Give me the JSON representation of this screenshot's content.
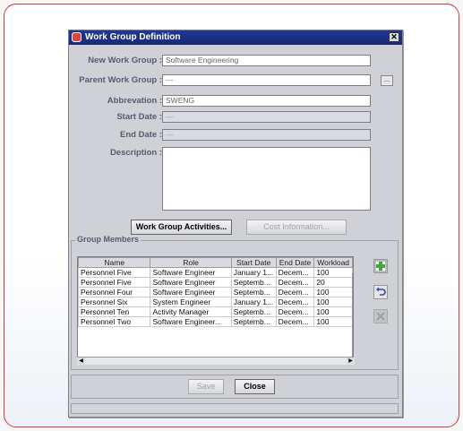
{
  "dialog": {
    "title": "Work Group Definition",
    "close_glyph": "✕"
  },
  "form": {
    "new_work_group_label": "New Work Group :",
    "new_work_group_value": "Software Engineering",
    "parent_work_group_label": "Parent Work Group :",
    "parent_work_group_value": "---",
    "browse_label": "...",
    "abbreviation_label": "Abbrevation :",
    "abbreviation_value": "SWENG",
    "start_date_label": "Start Date :",
    "start_date_value": "---",
    "end_date_label": "End Date :",
    "end_date_value": "---",
    "description_label": "Description :"
  },
  "buttons": {
    "work_group_activities": "Work Group Activities...",
    "cost_information": "Cost Information...",
    "save": "Save",
    "close": "Close"
  },
  "members": {
    "group_title": "Group Members",
    "columns": [
      "Name",
      "Role",
      "Start Date",
      "End Date",
      "Workload"
    ],
    "rows": [
      [
        "Personnel  Five",
        "Software Engineer",
        "January 1...",
        "Decem...",
        "100"
      ],
      [
        "Personnel  Five",
        "Software Engineer",
        "Septemb...",
        "Decem...",
        "20"
      ],
      [
        "Personnel  Four",
        "Software Engineer",
        "Septemb...",
        "Decem...",
        "100"
      ],
      [
        "Personnel  Six",
        "System Engineer",
        "January 1...",
        "Decem...",
        "100"
      ],
      [
        "Personnel  Ten",
        "Activity Manager",
        "Septemb...",
        "Decem...",
        "100"
      ],
      [
        "Personnel  Two",
        "Software Engineer...",
        "Septemb...",
        "Decem...",
        "100"
      ]
    ]
  },
  "icons": {
    "add_member": "add-member-icon",
    "undo": "undo-icon",
    "remove": "remove-icon"
  },
  "colors": {
    "titlebar": "#1a3185",
    "frame_border": "#d23b3b",
    "scroll_thumb": "#a9aedb"
  }
}
